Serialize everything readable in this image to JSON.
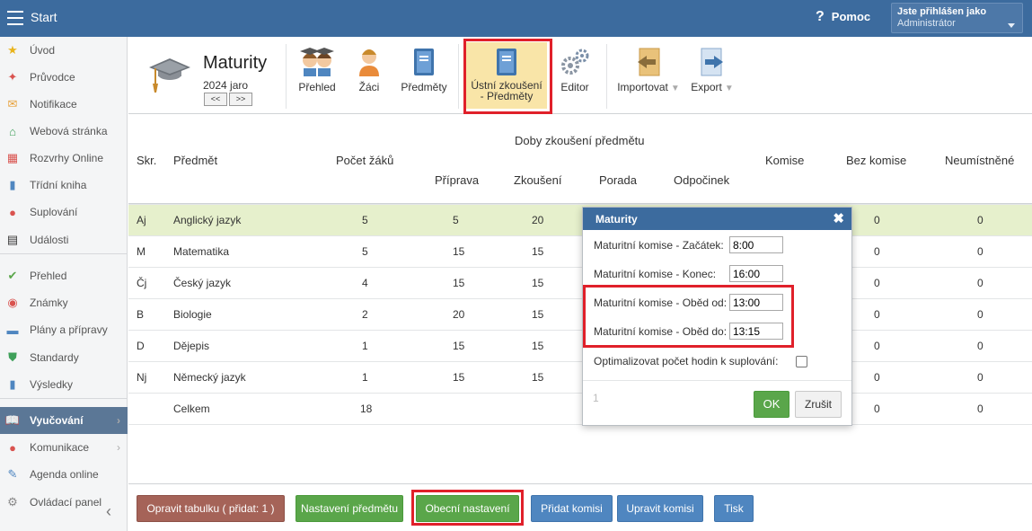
{
  "topbar": {
    "app_title": "Start",
    "help_label": "Pomoc",
    "help_icon": "?",
    "user_line1": "Jste přihlášen jako",
    "user_line2": "Administrátor"
  },
  "sidebar": {
    "items": [
      {
        "label": "Úvod",
        "icon": "star-icon",
        "glyph": "★",
        "color": "#e9b41c"
      },
      {
        "label": "Průvodce",
        "icon": "wand-icon",
        "glyph": "✦",
        "color": "#d9534f"
      },
      {
        "label": "Notifikace",
        "icon": "envelope-icon",
        "glyph": "✉",
        "color": "#e8a13a"
      },
      {
        "label": "Webová stránka",
        "icon": "home-icon",
        "glyph": "⌂",
        "color": "#3fa05a"
      },
      {
        "label": "Rozvrhy Online",
        "icon": "calendar-grid-icon",
        "glyph": "▦",
        "color": "#d9534f"
      },
      {
        "label": "Třídní kniha",
        "icon": "book-icon",
        "glyph": "▮",
        "color": "#4f86c0"
      },
      {
        "label": "Suplování",
        "icon": "person-icon",
        "glyph": "●",
        "color": "#d9534f"
      },
      {
        "label": "Události",
        "icon": "calendar-icon",
        "glyph": "▤",
        "color": "#333333"
      },
      {
        "label": "Přehled",
        "icon": "check-circle-icon",
        "glyph": "✔",
        "color": "#5aa64a"
      },
      {
        "label": "Známky",
        "icon": "grade-icon",
        "glyph": "◉",
        "color": "#d9534f"
      },
      {
        "label": "Plány a přípravy",
        "icon": "briefcase-icon",
        "glyph": "▬",
        "color": "#4f86c0"
      },
      {
        "label": "Standardy",
        "icon": "shield-icon",
        "glyph": "⛊",
        "color": "#3fa05a"
      },
      {
        "label": "Výsledky",
        "icon": "bar-chart-icon",
        "glyph": "▮",
        "color": "#4f86c0"
      },
      {
        "label": "Vyučování",
        "icon": "open-book-icon",
        "glyph": "📖",
        "color": "#ffffff"
      },
      {
        "label": "Komunikace",
        "icon": "chat-icon",
        "glyph": "●",
        "color": "#d9534f"
      },
      {
        "label": "Agenda online",
        "icon": "pencil-icon",
        "glyph": "✎",
        "color": "#4f86c0"
      },
      {
        "label": "Ovládací panel",
        "icon": "gear-icon",
        "glyph": "⚙",
        "color": "#888888"
      }
    ],
    "collapse_glyph": "‹"
  },
  "toolbar": {
    "title": "Maturity",
    "year": "2024 jaro",
    "prev": "<<",
    "next": ">>",
    "buttons": {
      "prehled": "Přehled",
      "zaci": "Žáci",
      "predmety": "Předměty",
      "ustni_line1": "Ústní zkoušení",
      "ustni_line2": "- Předměty",
      "editor": "Editor",
      "import": "Importovat",
      "export": "Export"
    }
  },
  "table": {
    "headers": {
      "skr": "Skr.",
      "predmet": "Předmět",
      "pocet": "Počet žáků",
      "group": "Doby zkoušení předmětu",
      "priprava": "Příprava",
      "zkouseni": "Zkoušení",
      "porada": "Porada",
      "odpocinek": "Odpočinek",
      "komise": "Komise",
      "bez_komise": "Bez komise",
      "neumistene": "Neumístněné"
    },
    "rows": [
      {
        "skr": "Aj",
        "predmet": "Anglický jazyk",
        "pocet": "5",
        "priprava": "5",
        "zkouseni": "20",
        "bez": "0",
        "neum": "0"
      },
      {
        "skr": "M",
        "predmet": "Matematika",
        "pocet": "5",
        "priprava": "15",
        "zkouseni": "15",
        "bez": "0",
        "neum": "0"
      },
      {
        "skr": "Čj",
        "predmet": "Český jazyk",
        "pocet": "4",
        "priprava": "15",
        "zkouseni": "15",
        "bez": "0",
        "neum": "0"
      },
      {
        "skr": "B",
        "predmet": "Biologie",
        "pocet": "2",
        "priprava": "20",
        "zkouseni": "15",
        "bez": "0",
        "neum": "0"
      },
      {
        "skr": "D",
        "predmet": "Dějepis",
        "pocet": "1",
        "priprava": "15",
        "zkouseni": "15",
        "bez": "0",
        "neum": "0"
      },
      {
        "skr": "Nj",
        "predmet": "Německý jazyk",
        "pocet": "1",
        "priprava": "15",
        "zkouseni": "15",
        "bez": "0",
        "neum": "0"
      }
    ],
    "total": {
      "label": "Celkem",
      "pocet": "18",
      "bez": "0",
      "neum": "0"
    }
  },
  "dialog": {
    "title": "Maturity",
    "close": "✖",
    "start_label": "Maturitní komise - Začátek:",
    "start_value": "8:00",
    "end_label": "Maturitní komise - Konec:",
    "end_value": "16:00",
    "lunch_from_label": "Maturitní komise - Oběd od:",
    "lunch_from_value": "13:00",
    "lunch_to_label": "Maturitní komise - Oběd do:",
    "lunch_to_value": "13:15",
    "optimize_label": "Optimalizovat počet hodin k suplování:",
    "page": "1",
    "ok": "OK",
    "cancel": "Zrušit"
  },
  "bottom": {
    "fix_table": "Opravit tabulku ( přidat: 1 )",
    "subject_settings": "Nastavení předmětu",
    "general_settings": "Obecní nastavení",
    "add_commission": "Přidat komisi",
    "edit_commission": "Upravit komisi",
    "print": "Tisk"
  },
  "colors": {
    "header_blue": "#3c6b9e",
    "highlight_row": "#e6f0cc",
    "selected_tab": "#f9e5a8",
    "annotation_red": "#e0202a"
  }
}
